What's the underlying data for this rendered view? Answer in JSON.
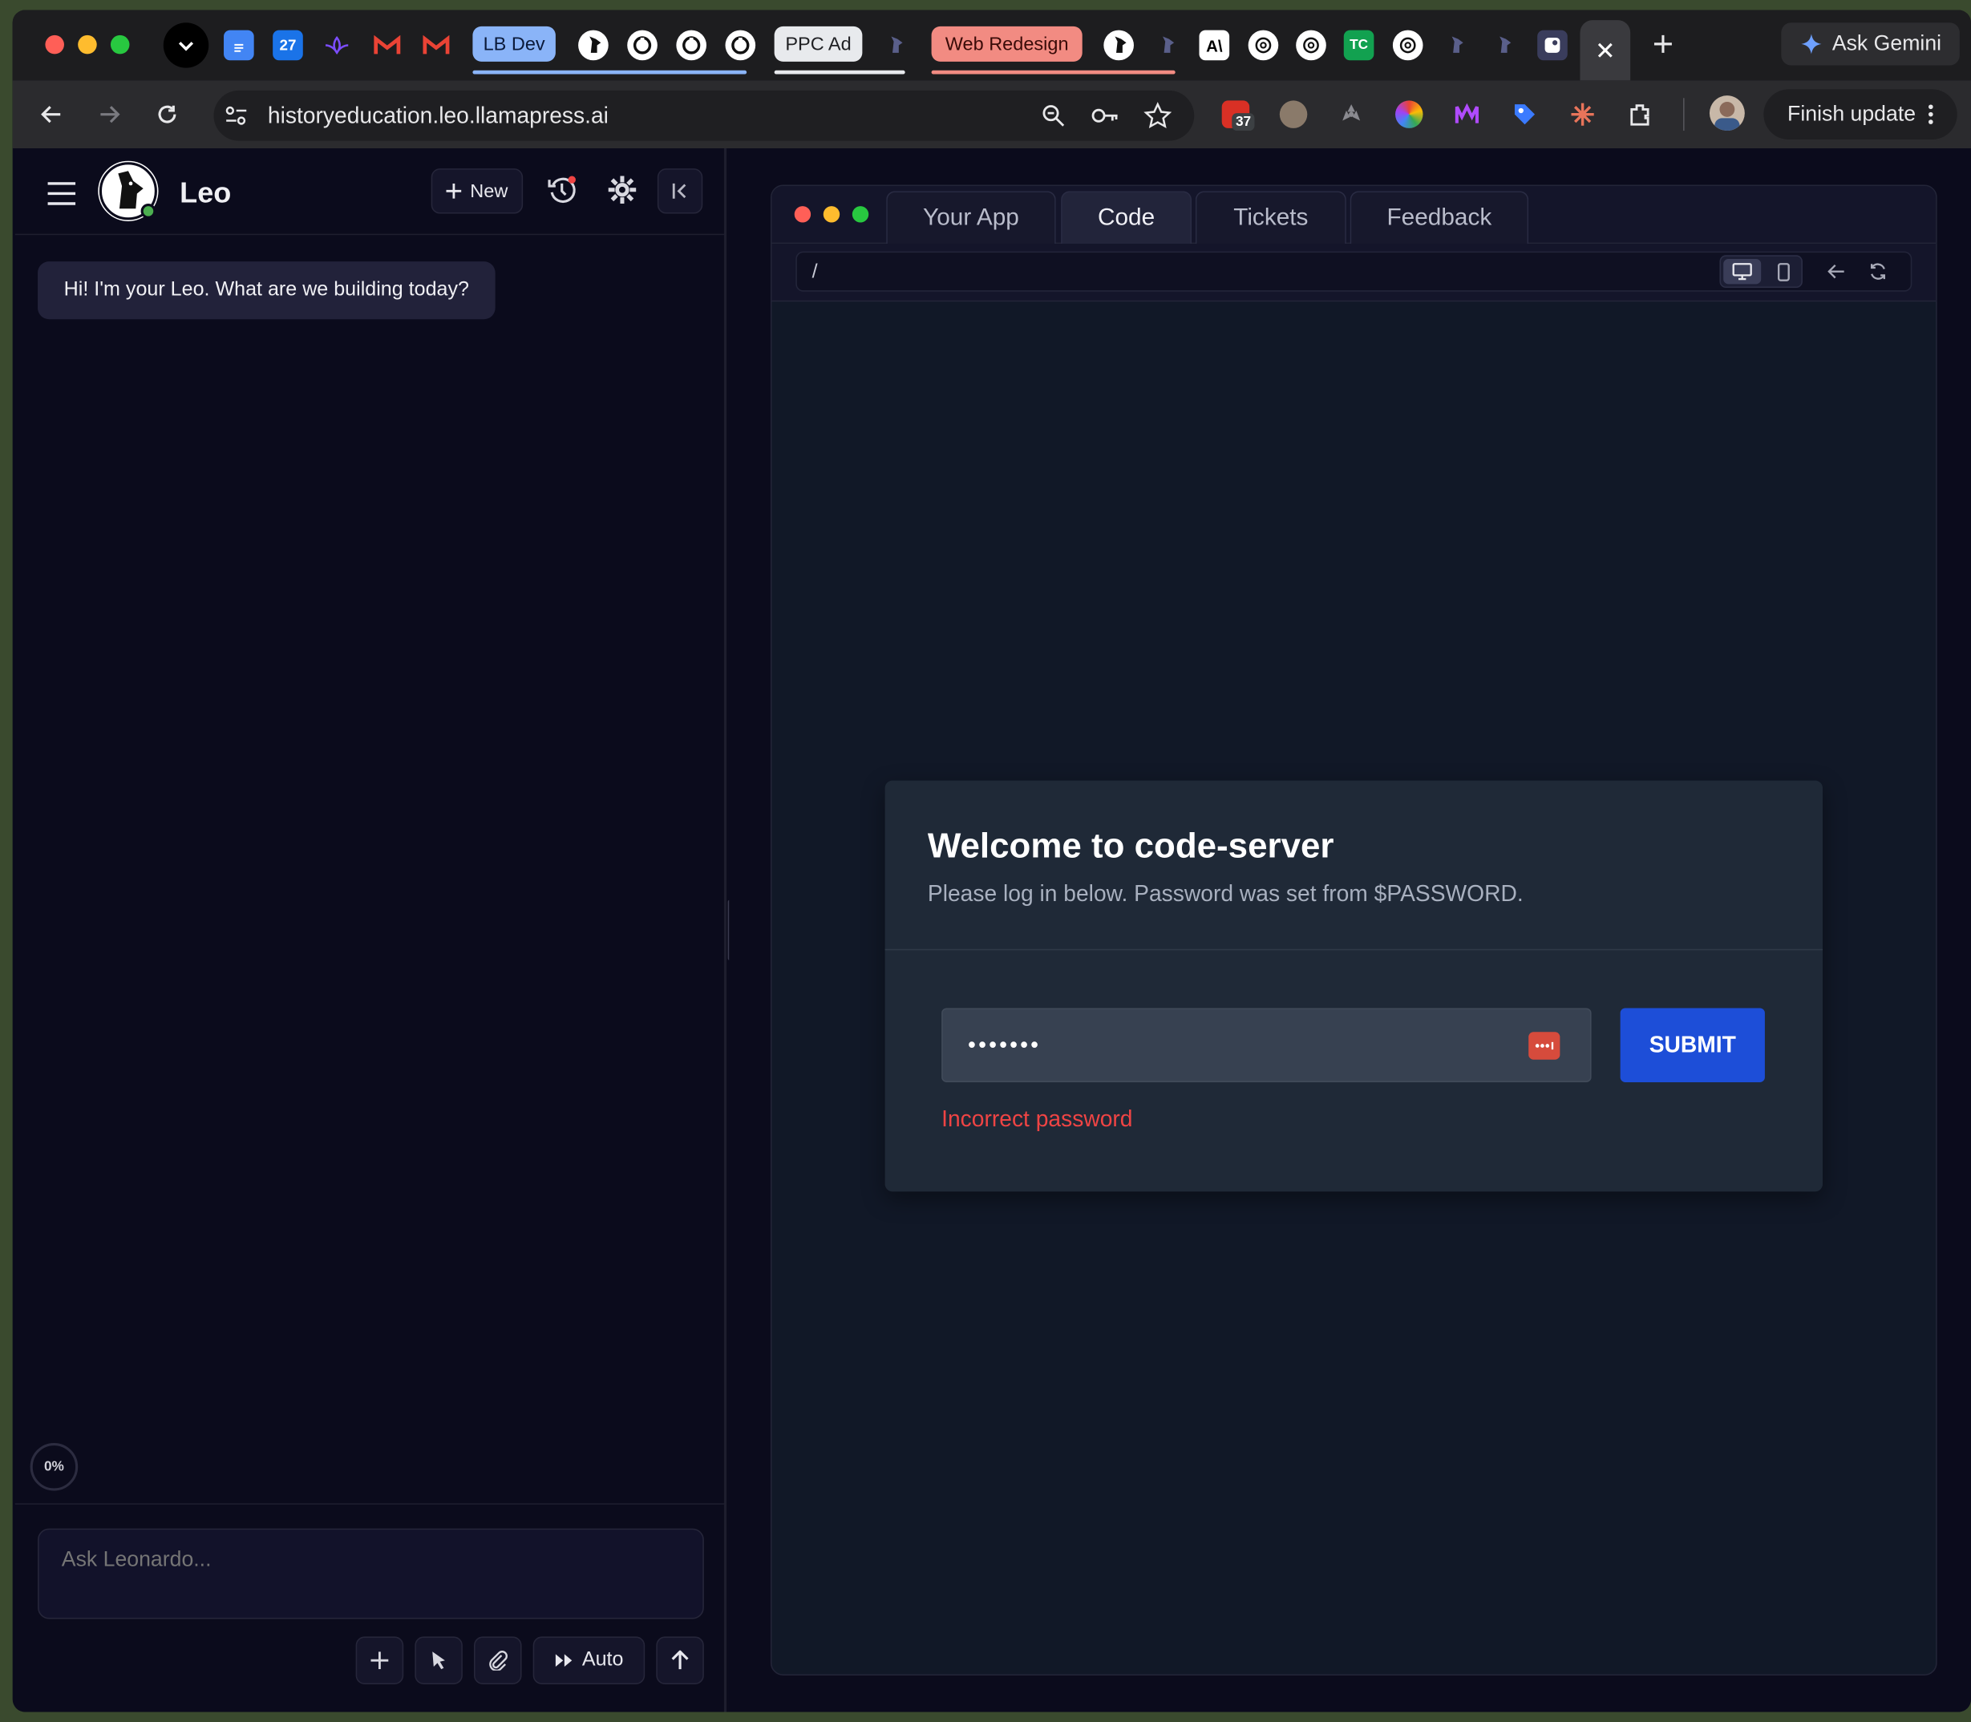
{
  "browser": {
    "tab_pills": {
      "lb_dev": "LB Dev",
      "ppc_ad": "PPC Ad",
      "web_redesign": "Web Redesign"
    },
    "calendar_day": "27",
    "ask_gemini": "Ask Gemini",
    "url": "historyeducation.leo.llamapress.ai",
    "extension_badge": "37",
    "finish_update": "Finish update",
    "colors": {
      "lb_dev": "#8ab4f8",
      "web_redesign": "#f28b82",
      "ppc_ad": "#e8eaed"
    }
  },
  "chat": {
    "title": "Leo",
    "new_label": "New",
    "greeting": "Hi! I'm your Leo. What are we building today?",
    "progress": "0%",
    "input_placeholder": "Ask Leonardo...",
    "auto_label": "Auto"
  },
  "preview": {
    "tabs": [
      "Your App",
      "Code",
      "Tickets",
      "Feedback"
    ],
    "active_tab": "Code",
    "path": "/",
    "login": {
      "heading": "Welcome to code-server",
      "subtitle": "Please log in below. Password was set from $PASSWORD.",
      "password_value": "•••••••",
      "submit_label": "SUBMIT",
      "error": "Incorrect password"
    }
  }
}
